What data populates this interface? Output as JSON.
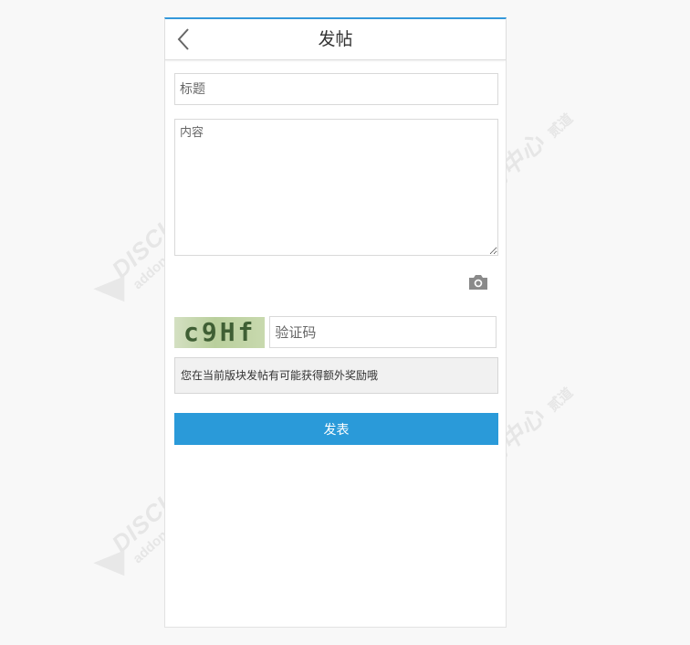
{
  "header": {
    "title": "发帖"
  },
  "form": {
    "title_placeholder": "标题",
    "content_placeholder": "内容",
    "captcha_text": "c9Hf",
    "captcha_placeholder": "验证码",
    "notice": "您在当前版块发帖有可能获得额外奖励哦",
    "submit_label": "发表"
  },
  "watermark": {
    "logo": "DISCUZ!应用中心",
    "sub": "addon.dismall.com",
    "brand": "贰道"
  },
  "colors": {
    "accent": "#2a9ad9",
    "top_border": "#3498db"
  },
  "icons": {
    "back": "chevron-left-icon",
    "camera": "camera-icon"
  }
}
